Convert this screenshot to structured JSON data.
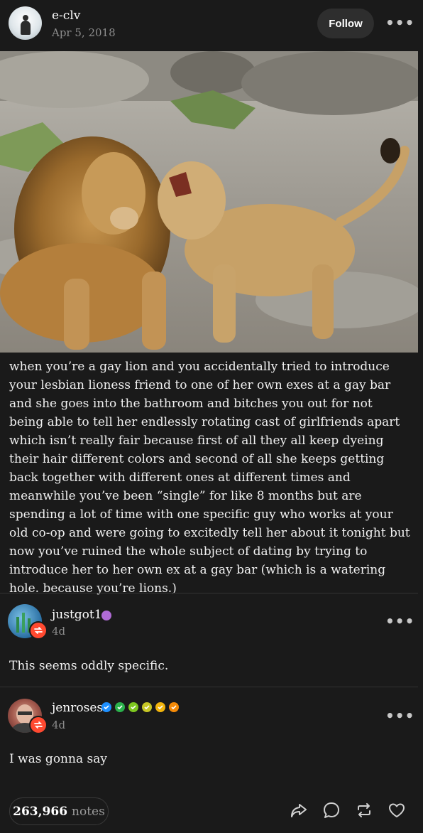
{
  "post": {
    "author": "e-clv",
    "date": "Apr 5, 2018",
    "follow_label": "Follow",
    "more_label": "•••",
    "caption": "when you’re a gay lion and you accidentally tried to introduce your lesbian lioness friend to one of her own exes at a gay bar and she goes into the bathroom and bitches you out for not being able to tell her endlessly rotating cast of girlfriends apart which isn’t really fair because first of all they all keep dyeing their hair different colors and second of all she keeps getting back together with different ones at different times and meanwhile you’ve been “single” for like 8 months but are spending a lot of time with one specific guy who works at your old co-op and were going to excitedly tell her about it tonight but now you’ve ruined the whole subject of dating by trying to introduce her to her own ex at a gay bar (which is a watering hole. because you’re lions.)"
  },
  "replies": [
    {
      "name": "justgot1",
      "time": "4d",
      "text": "This seems oddly specific.",
      "more": "•••",
      "badge_color": "#b06bd6"
    },
    {
      "name": "jenroses",
      "time": "4d",
      "text": "I was gonna say",
      "more": "•••",
      "badge_colors": [
        "#1e90ff",
        "#2bb24c",
        "#7ec820",
        "#c7c726",
        "#f2b40c",
        "#f58a07"
      ]
    }
  ],
  "footer": {
    "notes_count": "263,966",
    "notes_label": "notes",
    "icons": [
      "share-icon",
      "reply-icon",
      "reblog-icon",
      "like-icon"
    ]
  }
}
